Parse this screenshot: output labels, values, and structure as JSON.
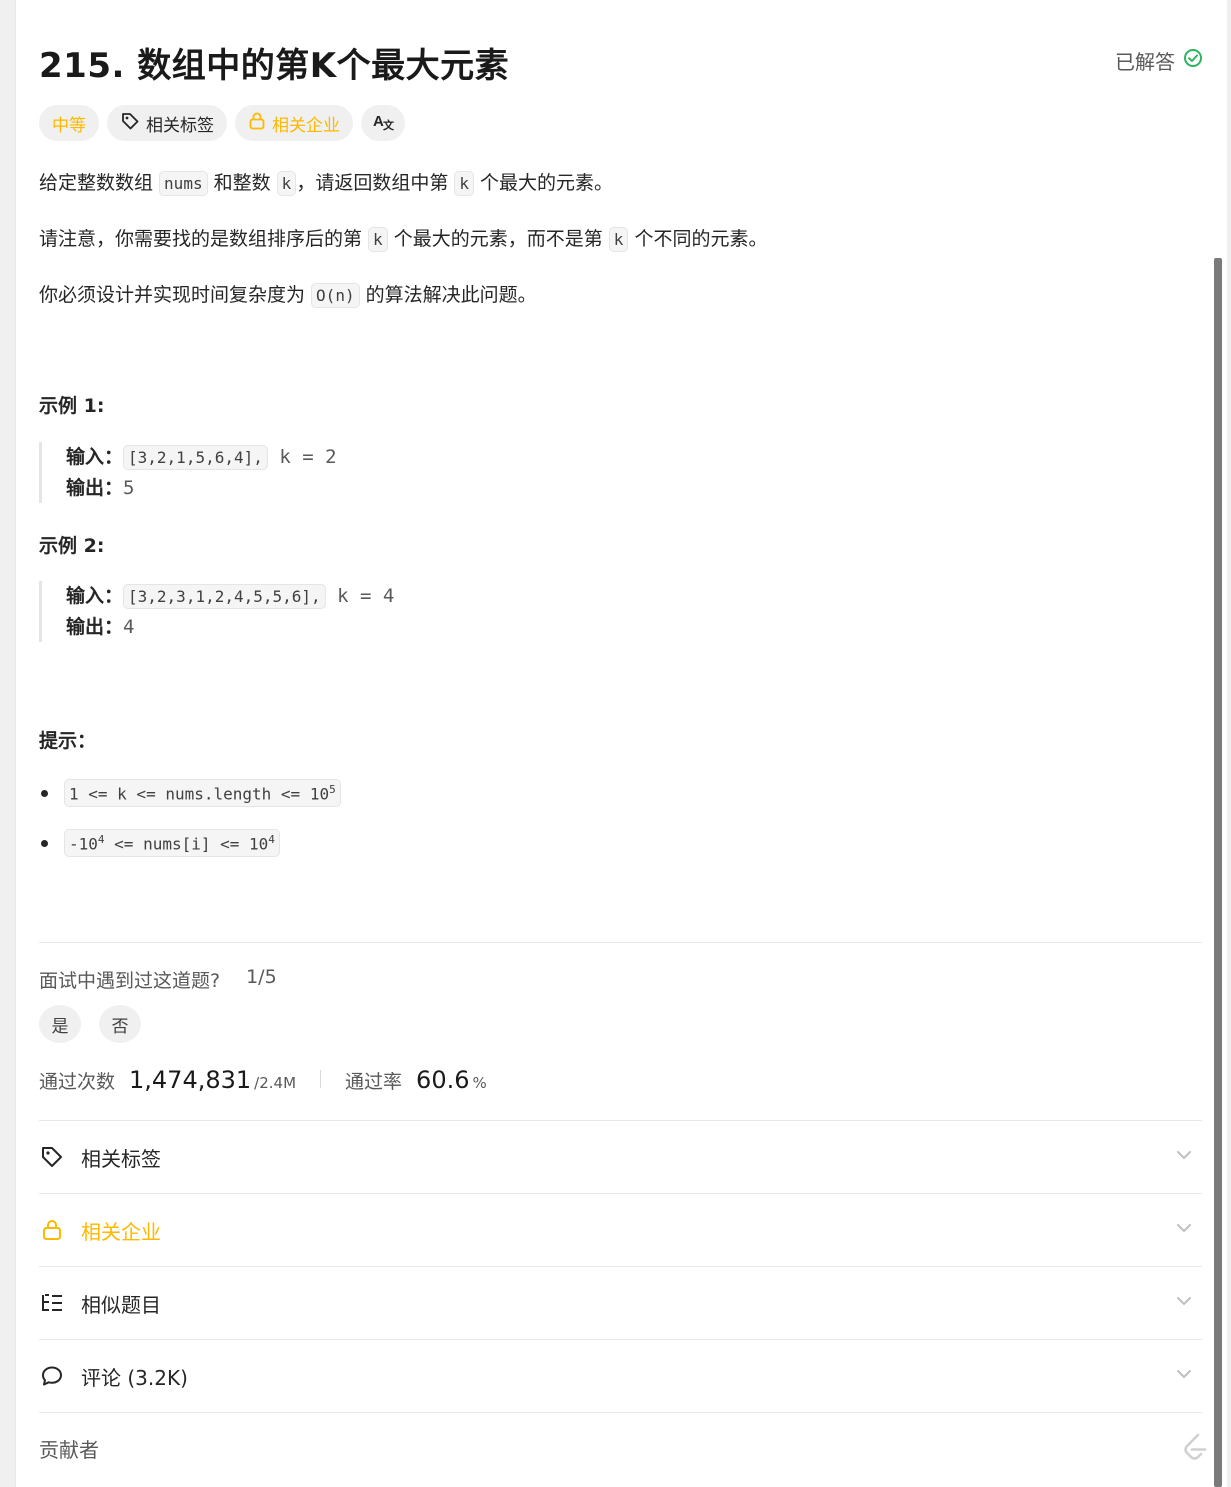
{
  "title": "215. 数组中的第K个最大元素",
  "solved_label": "已解答",
  "tags": {
    "difficulty": "中等",
    "related_tags": "相关标签",
    "related_companies": "相关企业"
  },
  "description": {
    "p1": {
      "a": "给定整数数组 ",
      "code1": "nums",
      "b": " 和整数 ",
      "code2": "k",
      "c": "，请返回数组中第 ",
      "code3": "k",
      "d": " 个最大的元素。"
    },
    "p2": {
      "a": "请注意，你需要找的是数组排序后的第 ",
      "code1": "k",
      "b": " 个最大的元素，而不是第 ",
      "code2": "k",
      "c": " 个不同的元素。"
    },
    "p3": {
      "a": "你必须设计并实现时间复杂度为 ",
      "code1": "O(n)",
      "b": " 的算法解决此问题。"
    }
  },
  "examples": [
    {
      "title": "示例 1:",
      "input_label": "输入：",
      "input_code": "[3,2,1,5,6,4],",
      "input_rest": " k = 2",
      "output_label": "输出：",
      "output": "5"
    },
    {
      "title": "示例 2:",
      "input_label": "输入：",
      "input_code": "[3,2,3,1,2,4,5,5,6],",
      "input_rest": " k = 4",
      "output_label": "输出：",
      "output": "4"
    }
  ],
  "hints_title": "提示：",
  "constraints": [
    {
      "pre": "1 <= k <= nums.length <= 10",
      "sup": "5",
      "post": ""
    },
    {
      "pre": "-10",
      "sup": "4",
      "post": " <= nums[i] <= 10",
      "sup2": "4"
    }
  ],
  "interview": {
    "question": "面试中遇到过这道题?",
    "ratio": "1/5",
    "yes": "是",
    "no": "否"
  },
  "stats": {
    "accepted_label": "通过次数",
    "accepted": "1,474,831",
    "submissions": "/2.4M",
    "rate_label": "通过率",
    "rate": "60.6",
    "rate_unit": "%"
  },
  "sections": {
    "tags": "相关标签",
    "companies": "相关企业",
    "similar": "相似题目",
    "comments": "评论 (3.2K)"
  },
  "contributors": "贡献者",
  "colors": {
    "accent_gold": "#ffb800",
    "solved_green": "#2db55d"
  }
}
